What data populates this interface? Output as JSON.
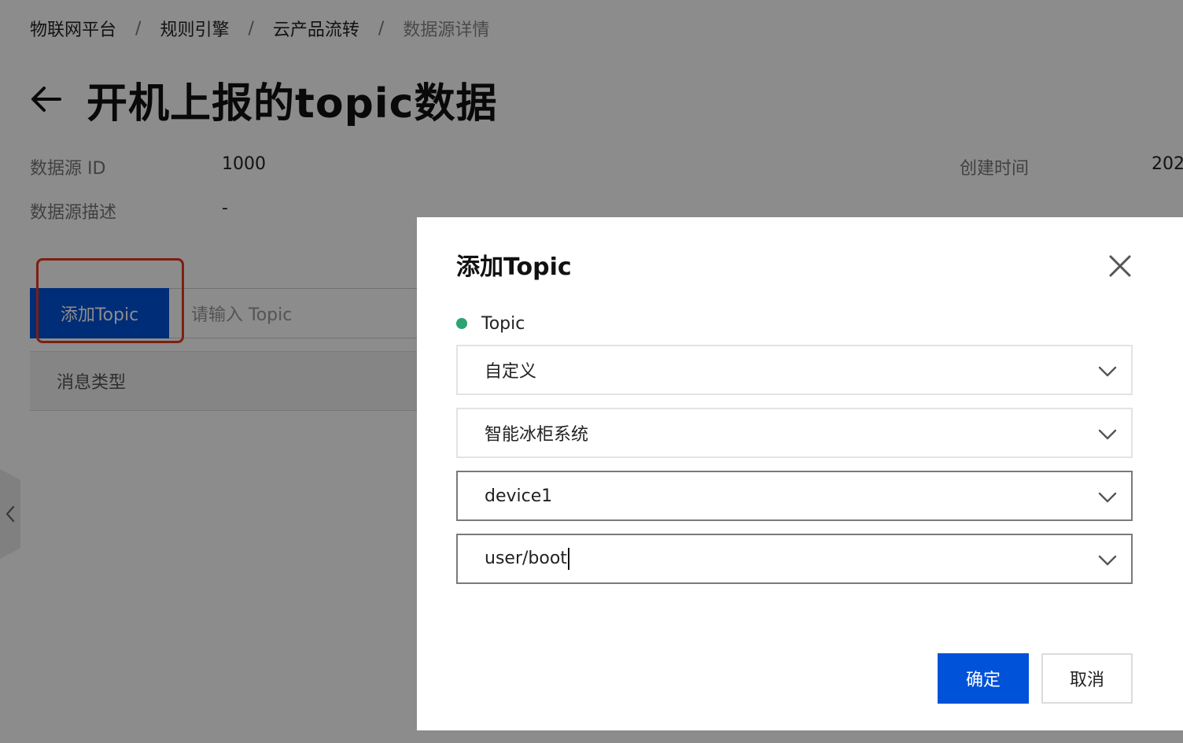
{
  "breadcrumb": {
    "items": [
      "物联网平台",
      "规则引擎",
      "云产品流转",
      "数据源详情"
    ],
    "separator": "/"
  },
  "page": {
    "title": "开机上报的topic数据",
    "meta": {
      "id_label": "数据源 ID",
      "id_value": "1000",
      "created_label": "创建时间",
      "created_value": "202",
      "desc_label": "数据源描述",
      "desc_value": "-"
    },
    "toolbar": {
      "add_topic_label": "添加Topic",
      "search_placeholder": "请输入 Topic"
    },
    "table": {
      "columns": [
        "消息类型"
      ]
    }
  },
  "dialog": {
    "title": "添加Topic",
    "field_label": "Topic",
    "selects": [
      {
        "value": "自定义"
      },
      {
        "value": "智能冰柜系统"
      },
      {
        "value": "device1"
      },
      {
        "value": "user/boot"
      }
    ],
    "confirm_label": "确定",
    "cancel_label": "取消"
  },
  "colors": {
    "primary": "#0052d9",
    "highlight": "#e5391f",
    "status_dot": "#2ba471",
    "mask": "rgba(0,0,0,0.45)"
  },
  "icons": [
    "back-arrow-icon",
    "close-icon",
    "chevron-down-icon",
    "chevron-left-icon"
  ]
}
